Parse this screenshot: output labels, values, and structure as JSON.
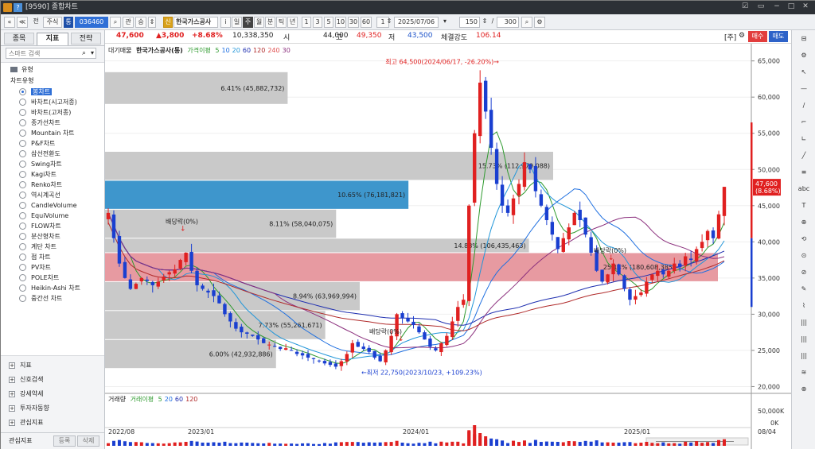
{
  "window": {
    "title": "[9590] 종합차트",
    "controls": [
      "☑",
      "▭",
      "−",
      "□",
      "✕"
    ]
  },
  "toolbar": {
    "nav_prev": "≪",
    "nav_label": "전",
    "market": "주식",
    "type_badge": "통",
    "code": "036460",
    "search_glyph": "⌕",
    "link_label": "관",
    "link2_label": "승",
    "stock_badge": "신",
    "stock_name": "한국가스공사",
    "periods": [
      "i",
      "일",
      "주",
      "월",
      "분",
      "틱",
      "년"
    ],
    "selected_period": "주",
    "intervals": [
      "1",
      "3",
      "5",
      "10",
      "30",
      "60"
    ],
    "count_prefix": "1",
    "date": "2025/07/06",
    "bars_value": "150",
    "bars_total": "300"
  },
  "left_panel": {
    "tabs": [
      "종목",
      "지표",
      "전략"
    ],
    "active_tab": "지표",
    "search_placeholder": "스마트 검색",
    "tree_root": "유형",
    "tree_group": "차트유형",
    "chart_types": [
      "봉차트",
      "바차트(시고저종)",
      "바차트(고저종)",
      "종가선차트",
      "Mountain 차트",
      "P&F차트",
      "삼선전환도",
      "Swing차트",
      "Kagi차트",
      "Renko차트",
      "역시계곡선",
      "CandleVolume",
      "EquiVolume",
      "FLOW차트",
      "분산형차트",
      "계단 차트",
      "점 차트",
      "PV차트",
      "POLE차트",
      "Heikin-Ashi 차트",
      "중간선 차트"
    ],
    "selected_type": "봉차트",
    "bottom_items": [
      "지표",
      "신호검색",
      "강세약세",
      "투자자동향",
      "관심지표"
    ],
    "footer_label": "관심지표",
    "footer_btn_register": "등록",
    "footer_btn_delete": "삭제"
  },
  "quote": {
    "price": "47,600",
    "change": "▲3,800",
    "change_pct": "+8.68%",
    "volume": "10,338,350",
    "open_label": "시",
    "open": "44,000",
    "high_label": "고",
    "high": "49,350",
    "low_label": "저",
    "low": "43,500",
    "strength_label": "체결강도",
    "strength": "106.14",
    "unit_label": "[주]",
    "sell_label": "매수",
    "buy_label": "매도"
  },
  "legend": {
    "vp_label": "대기매물",
    "name_label": "한국가스공사(통)",
    "ma_label": "가격이평",
    "ma_periods": [
      "5",
      "10",
      "20",
      "60",
      "120",
      "240",
      "30"
    ],
    "ma_colors": [
      "#2e9a2e",
      "#1e6fe0",
      "#2196d9",
      "#1f2fb0",
      "#b02a2a",
      "#e05050",
      "#8b2f7d"
    ],
    "vol_label": "거래량",
    "vol_ma_label": "거래이평",
    "vol_ma_periods": [
      "5",
      "20",
      "60",
      "120"
    ]
  },
  "annotations": {
    "high": "최고 64,500(2024/06/17, -26.20%)→",
    "low": "←최저 22,750(2023/10/23, +109.23%)",
    "dividend_labels": [
      "배당락(0%)",
      "배당락(0%)",
      "배당락(0%)"
    ],
    "current_price_tag": "47,600",
    "current_pct_tag": "(8.68%)"
  },
  "chart_data": {
    "type": "candlestick",
    "y_ticks": [
      20000,
      25000,
      30000,
      35000,
      40000,
      45000,
      50000,
      55000,
      60000,
      65000
    ],
    "y_tick_labels": [
      "20,000",
      "25,000",
      "30,000",
      "35,000",
      "40,000",
      "45,000",
      "50,000",
      "55,000",
      "60,000",
      "65,000"
    ],
    "ylim": [
      19500,
      66500
    ],
    "x_labels": [
      "2022/08",
      "2023/01",
      "2024/01",
      "2025/01",
      "08/04"
    ],
    "volume_ticks": [
      "50,000K",
      "0K"
    ],
    "volume_profile": [
      {
        "low": 63500,
        "high": 59000,
        "label": "6.41% (45,882,732)",
        "value": 6.41,
        "highlight": false
      },
      {
        "low": 52500,
        "high": 48500,
        "label": "15.73% (112,979,088)",
        "value": 15.73,
        "highlight": false
      },
      {
        "low": 48500,
        "high": 44500,
        "label": "10.65% (76,181,821)",
        "value": 10.65,
        "highlight": "blue"
      },
      {
        "low": 44500,
        "high": 40500,
        "label": "8.11% (58,040,075)",
        "value": 8.11,
        "highlight": false
      },
      {
        "low": 40500,
        "high": 38500,
        "label": "14.88% (106,435,463)",
        "value": 14.88,
        "highlight": false
      },
      {
        "low": 38500,
        "high": 34500,
        "label": "25.14% (180,608,385)",
        "value": 25.14,
        "highlight": "red"
      },
      {
        "low": 34500,
        "high": 30500,
        "label": "8.94% (63,969,994)",
        "value": 8.94,
        "highlight": false
      },
      {
        "low": 30500,
        "high": 26500,
        "label": "7.73% (55,261,671)",
        "value": 7.73,
        "highlight": false
      },
      {
        "low": 26500,
        "high": 22500,
        "label": "6.00% (42,932,886)",
        "value": 6.0,
        "highlight": false
      }
    ],
    "close_series": [
      44000,
      40500,
      37000,
      35000,
      33500,
      34200,
      35000,
      34600,
      34000,
      34500,
      35200,
      35800,
      36200,
      37500,
      38500,
      36000,
      34000,
      33500,
      33000,
      32500,
      31500,
      30000,
      29000,
      28000,
      27500,
      27300,
      27000,
      26500,
      26000,
      25800,
      25500,
      25200,
      25300,
      25000,
      24500,
      24300,
      24000,
      23800,
      23500,
      23200,
      23000,
      22750,
      23500,
      24500,
      26000,
      25500,
      25200,
      24800,
      24000,
      23500,
      25000,
      27000,
      30000,
      29500,
      29000,
      28500,
      27500,
      26500,
      25500,
      25000,
      26000,
      27000,
      29000,
      31000,
      32000,
      45000,
      55000,
      62000,
      58000,
      53000,
      48000,
      45000,
      44000,
      46000,
      48000,
      51000,
      50000,
      47000,
      45000,
      43000,
      41000,
      39000,
      40500,
      42000,
      44000,
      43000,
      41000,
      38500,
      36000,
      34500,
      35500,
      37000,
      35500,
      33500,
      32000,
      32500,
      33000,
      34500,
      35500,
      36000,
      35500,
      36000,
      37000,
      36500,
      38000,
      37500,
      39000,
      40000,
      41500,
      40500,
      43800,
      47600
    ]
  },
  "right_tools": [
    "⊟",
    "⚙",
    "↖",
    "—",
    "∕",
    "⌐",
    "∟",
    "╱",
    "≡",
    "abc",
    "T",
    "⊕",
    "⟲",
    "⊙",
    "⊘",
    "✎",
    "⌇",
    "|||",
    "|||",
    "|||",
    "≋",
    "⊕"
  ]
}
